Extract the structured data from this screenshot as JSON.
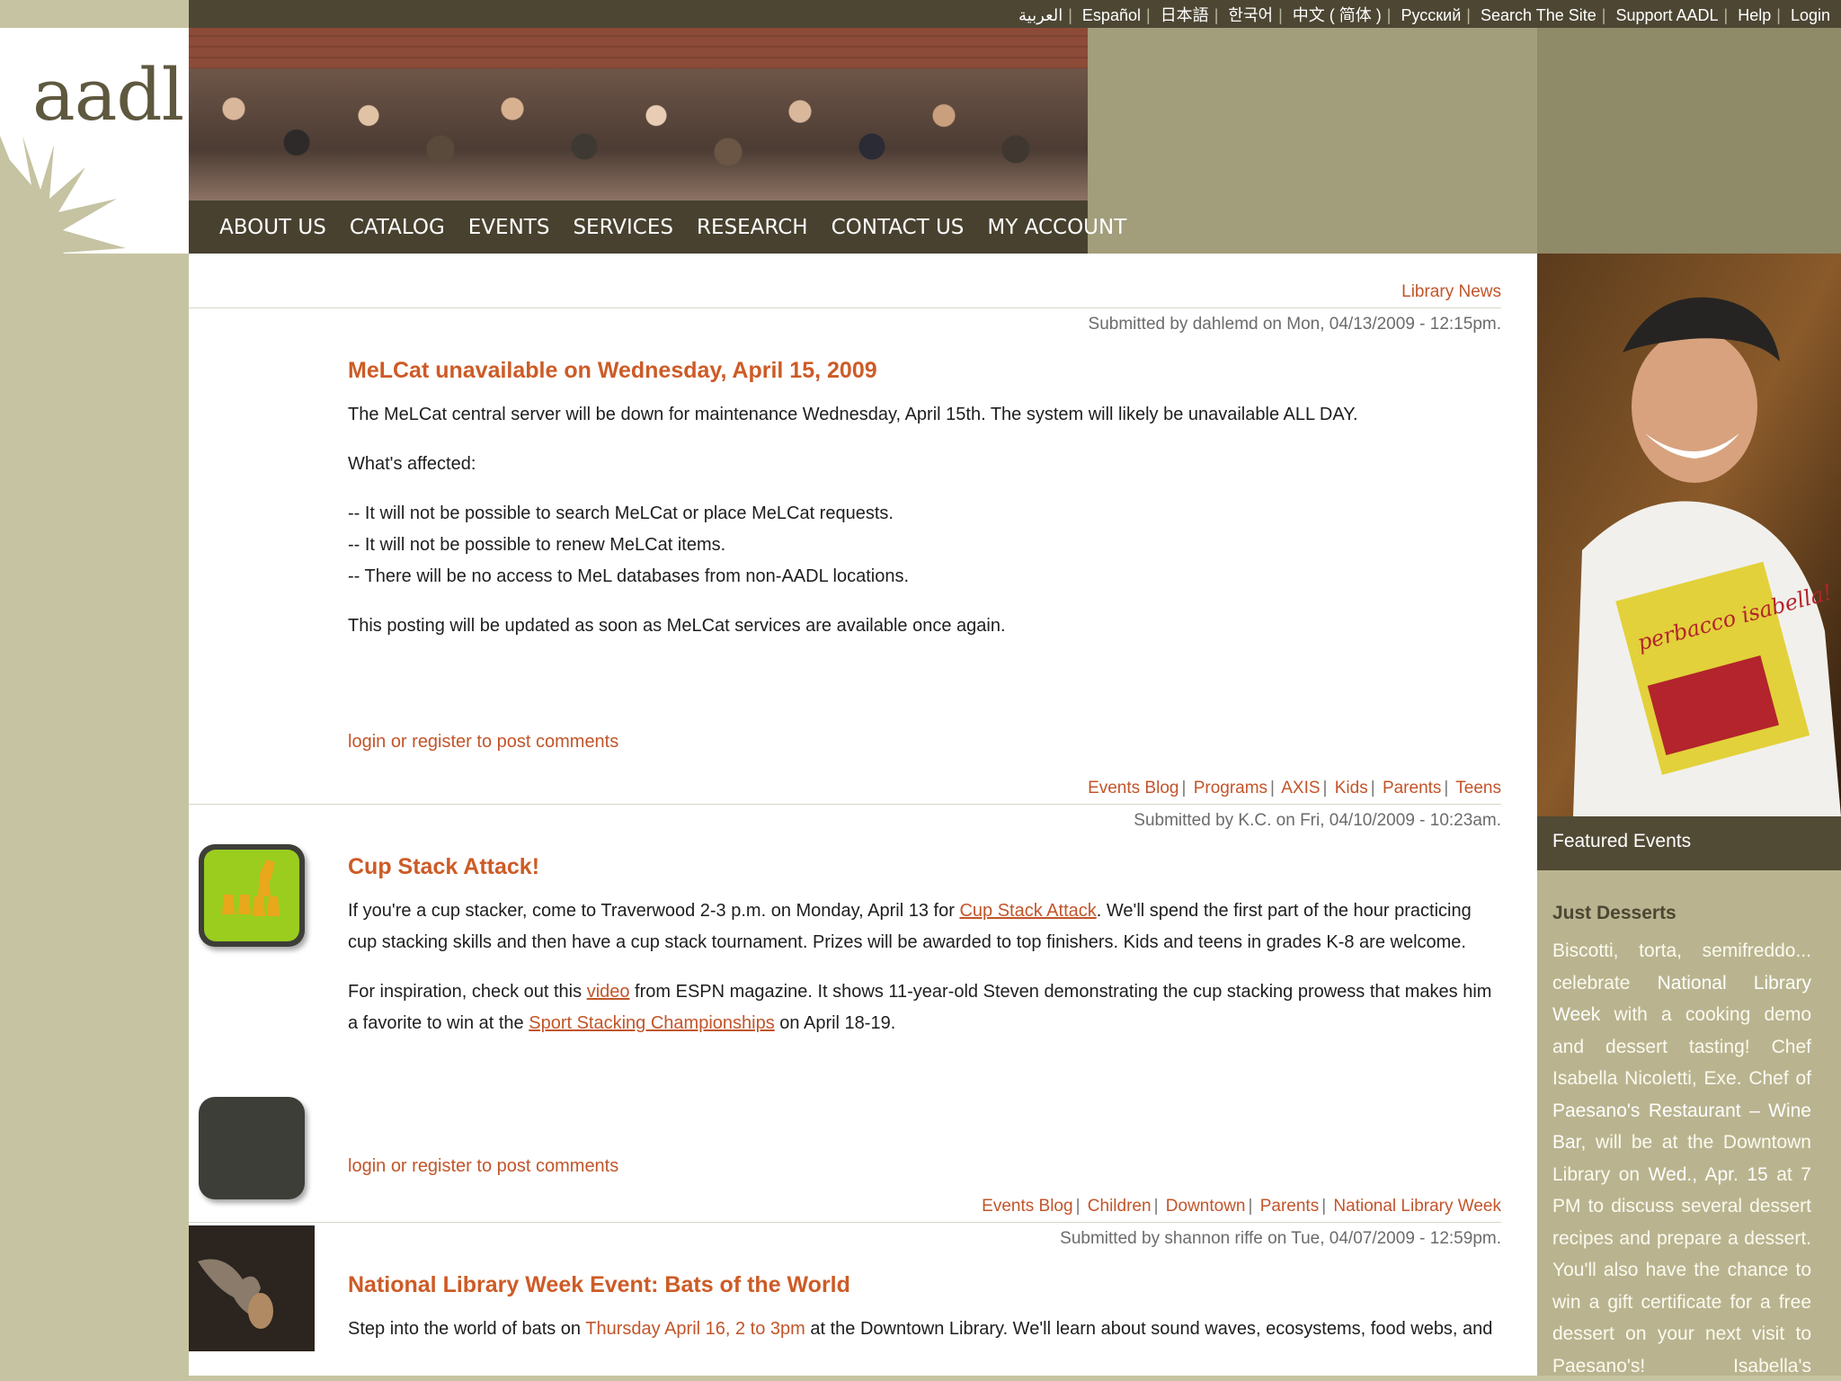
{
  "topbar": {
    "links": [
      "العربية",
      "Español",
      "日本語",
      "한국어",
      "中文 ( 简体 )",
      "Русский",
      "Search The Site",
      "Support AADL",
      "Help",
      "Login"
    ]
  },
  "logo": {
    "text": "aadl.org"
  },
  "nav": {
    "items": [
      "ABOUT US",
      "CATALOG",
      "EVENTS",
      "SERVICES",
      "RESEARCH",
      "CONTACT US",
      "MY ACCOUNT"
    ]
  },
  "posts": [
    {
      "tags": [
        "Library News"
      ],
      "submitted": "Submitted by dahlemd on Mon, 04/13/2009 - 12:15pm.",
      "title": "MeLCat unavailable on Wednesday, April 15, 2009",
      "p1": "The MeLCat central server will be down for maintenance Wednesday, April 15th. The system will likely be unavailable ALL DAY.",
      "p2": "What's affected:",
      "p3a": "-- It will not be possible to search MeLCat or place MeLCat requests.",
      "p3b": "-- It will not be possible to renew MeLCat items.",
      "p3c": "-- There will be no access to MeL databases from non-AADL locations.",
      "p4": "This posting will be updated as soon as MeLCat services are available once again.",
      "comments": "login or register to post comments"
    },
    {
      "tags": [
        "Events Blog",
        "Programs",
        "AXIS",
        "Kids",
        "Parents",
        "Teens"
      ],
      "submitted": "Submitted by K.C. on Fri, 04/10/2009 - 10:23am.",
      "title": "Cup Stack Attack!",
      "p1_before": "If you're a cup stacker, come to Traverwood 2-3 p.m. on Monday, April 13 for ",
      "p1_link": "Cup Stack Attack",
      "p1_after": ". We'll spend the first part of the hour practicing cup stacking skills and then have a cup stack tournament. Prizes will be awarded to top finishers. Kids and teens in grades K-8 are welcome.",
      "p2_before": "For inspiration, check out this ",
      "p2_link1": "video",
      "p2_middle": " from ESPN magazine. It shows 11-year-old Steven demonstrating the cup stacking prowess that makes him a favorite to win at the ",
      "p2_link2": "Sport Stacking Championships",
      "p2_after": " on April 18-19.",
      "comments": "login or register to post comments"
    },
    {
      "tags": [
        "Events Blog",
        "Children",
        "Downtown",
        "Parents",
        "National Library Week"
      ],
      "submitted": "Submitted by shannon riffe on Tue, 04/07/2009 - 12:59pm.",
      "title": "National Library Week Event: Bats of the World",
      "p1_before": "Step into the world of bats on ",
      "p1_hl": "Thursday April 16, 2 to 3pm",
      "p1_after": " at the Downtown Library. We'll learn about sound waves, ecosystems, food webs, and"
    }
  ],
  "featured": {
    "label": "Featured Events",
    "title": "Just Desserts",
    "t1": "Biscotti, torta, semifreddo... celebrate ",
    "t1_hl": "National Library Week",
    "t2": " with a cooking demo and dessert tasting! Chef Isabella Nicoletti, Exe. Chef of ",
    "t2_hl": "Paesano's Restaurant – Wine Bar",
    "t3": ", will be at the Downtown Library on ",
    "t3_hl": "Wed., Apr. 15",
    "t4": " at 7 PM to discuss several dessert recipes and prepare a dessert. You'll also have the chance to win a gift certificate for a free dessert on your next visit to Paesano's! Isabella's cookbook",
    "book_title": "perbacco isabella!"
  }
}
